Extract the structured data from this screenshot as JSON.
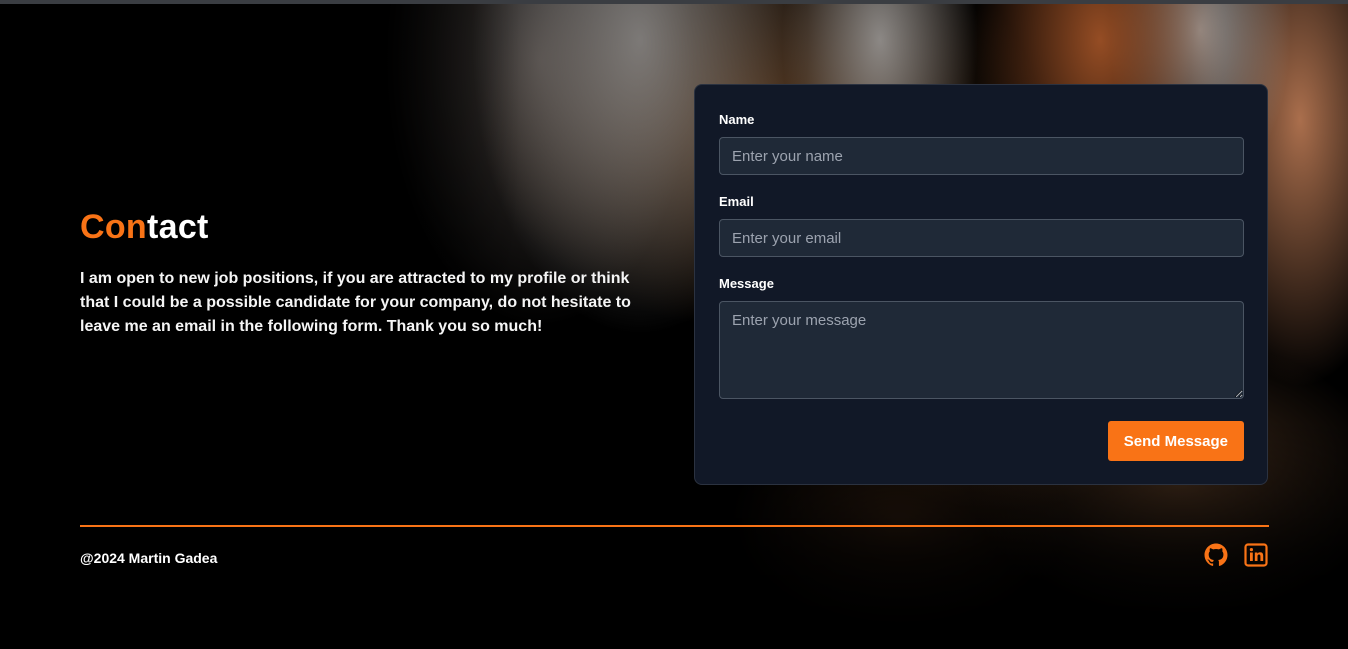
{
  "colors": {
    "accent": "#f97316",
    "card_background": "#111827",
    "input_background": "#1f2937",
    "input_border": "#4b5563",
    "page_background": "#000000"
  },
  "contact": {
    "title_accent": "Con",
    "title_rest": "tact",
    "description": "I am open to new job positions, if you are attracted to my profile or think that I could be a possible candidate for your company, do not hesitate to leave me an email in the following form. Thank you so much!"
  },
  "form": {
    "name": {
      "label": "Name",
      "placeholder": "Enter your name",
      "value": ""
    },
    "email": {
      "label": "Email",
      "placeholder": "Enter your email",
      "value": ""
    },
    "message": {
      "label": "Message",
      "placeholder": "Enter your message",
      "value": ""
    },
    "submit_label": "Send Message"
  },
  "footer": {
    "copyright": "@2024 Martin Gadea",
    "social": [
      {
        "icon": "github-icon"
      },
      {
        "icon": "linkedin-icon"
      }
    ]
  }
}
